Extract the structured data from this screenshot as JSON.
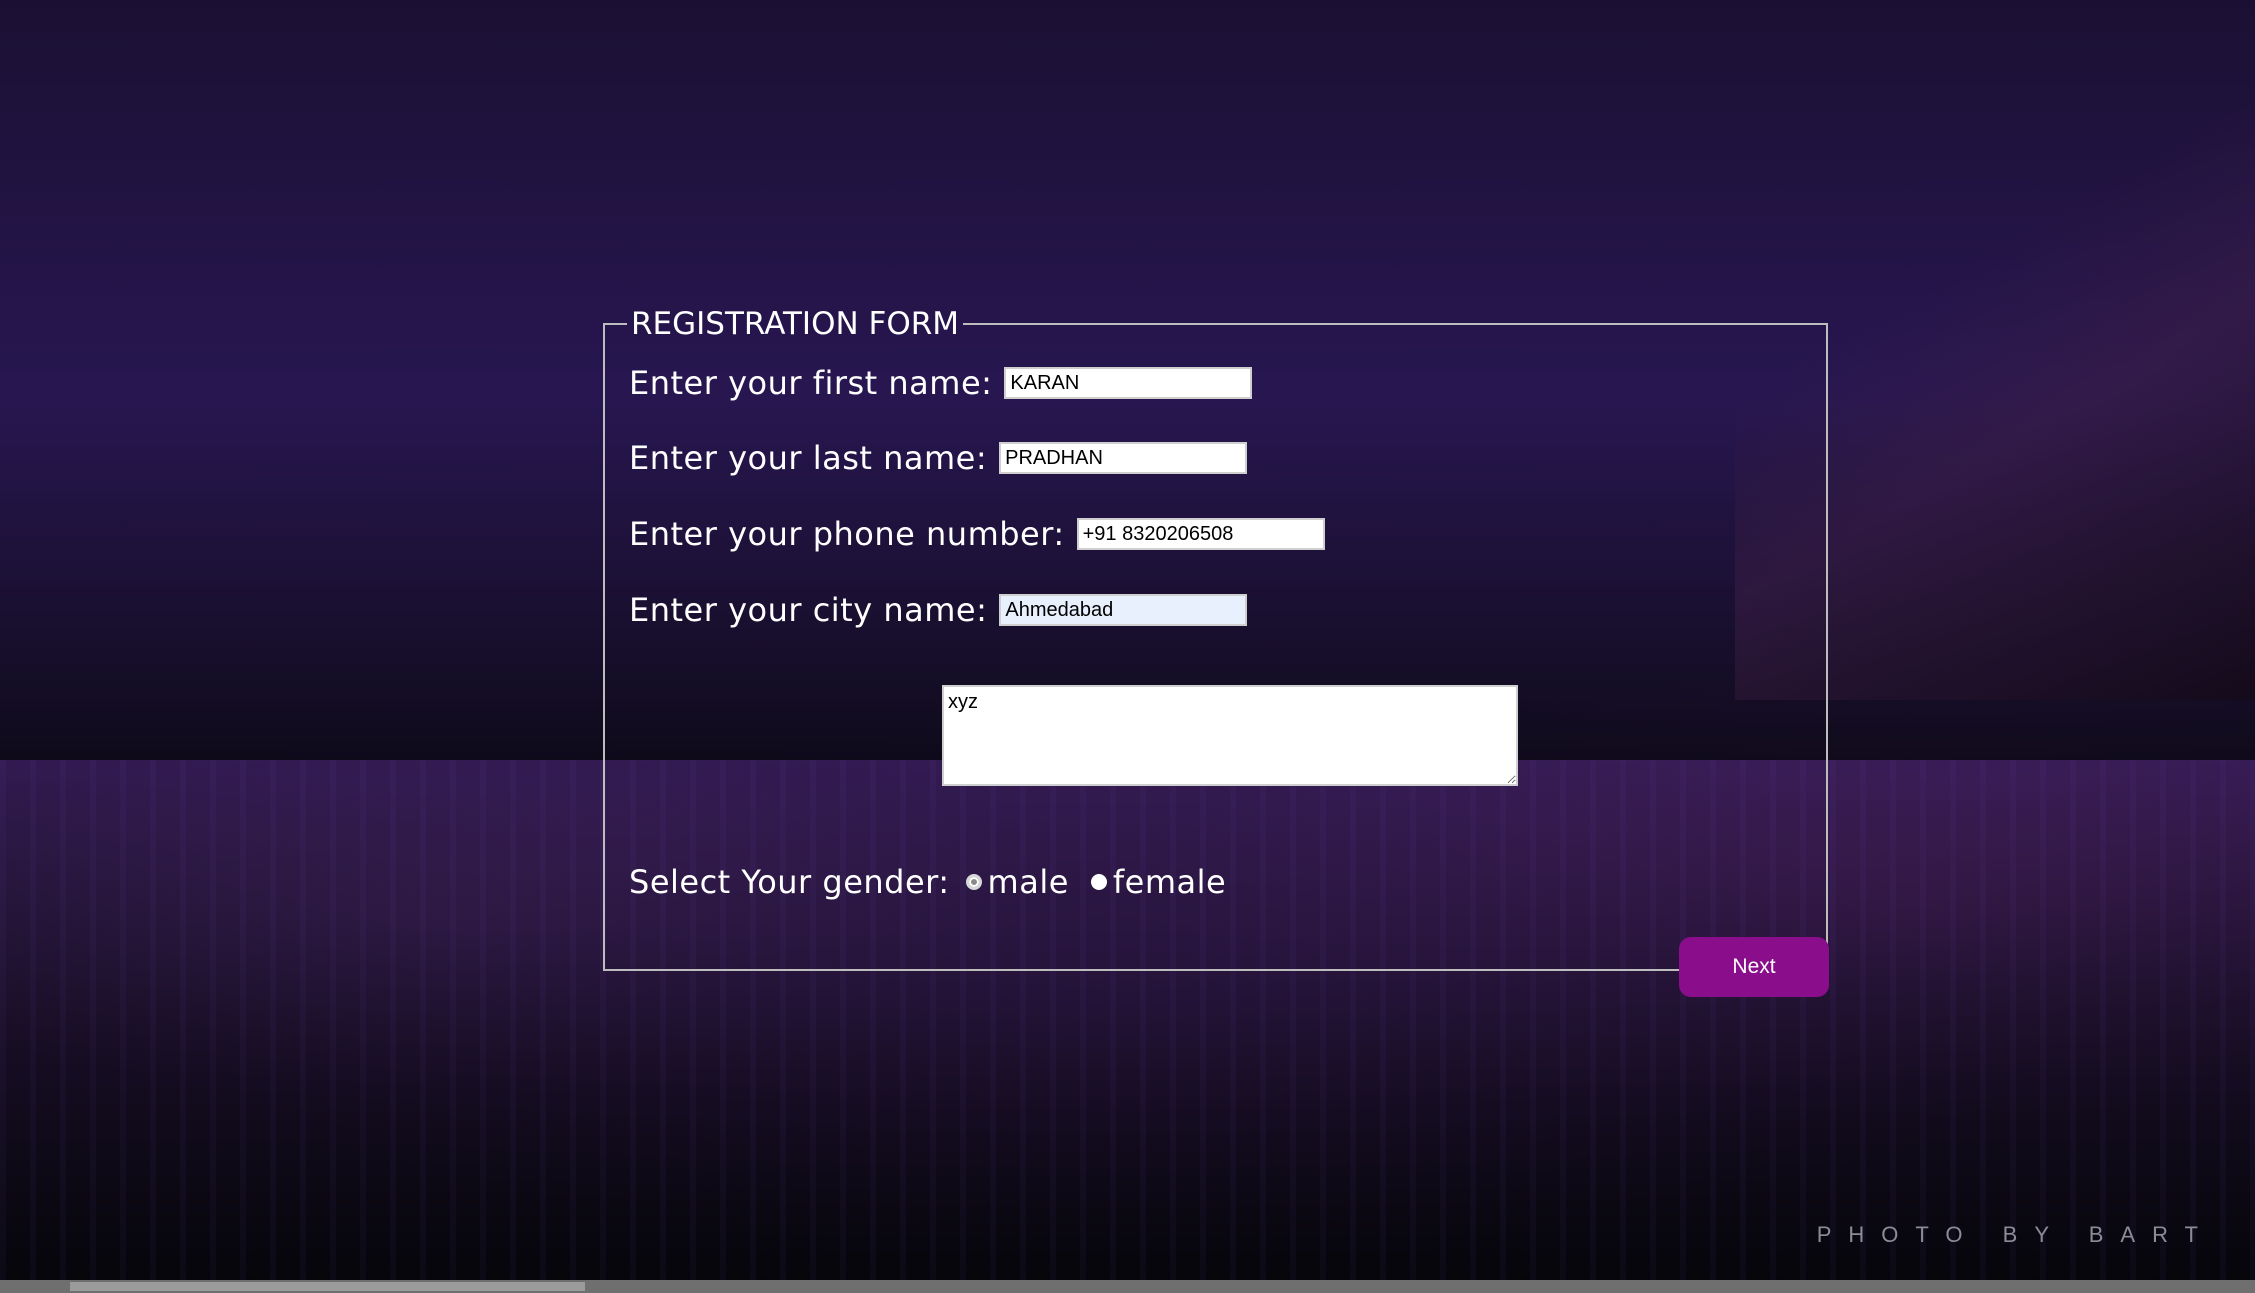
{
  "form": {
    "legend": "REGISTRATION FORM",
    "first_name": {
      "label": "Enter your first name:",
      "value": "KARAN"
    },
    "last_name": {
      "label": "Enter your last name:",
      "value": "PRADHAN"
    },
    "phone": {
      "label": "Enter your phone number:",
      "value": "+91 8320206508"
    },
    "city": {
      "label": "Enter your city name:",
      "value": "Ahmedabad"
    },
    "notes": {
      "value": "xyz"
    },
    "gender": {
      "label": "Select Your gender:",
      "options": [
        "male",
        "female"
      ]
    },
    "next_label": "Next"
  },
  "background": {
    "credit": "PHOTO BY BART"
  },
  "colors": {
    "accent": "#8a0e8c",
    "border": "#bdbdbd"
  }
}
